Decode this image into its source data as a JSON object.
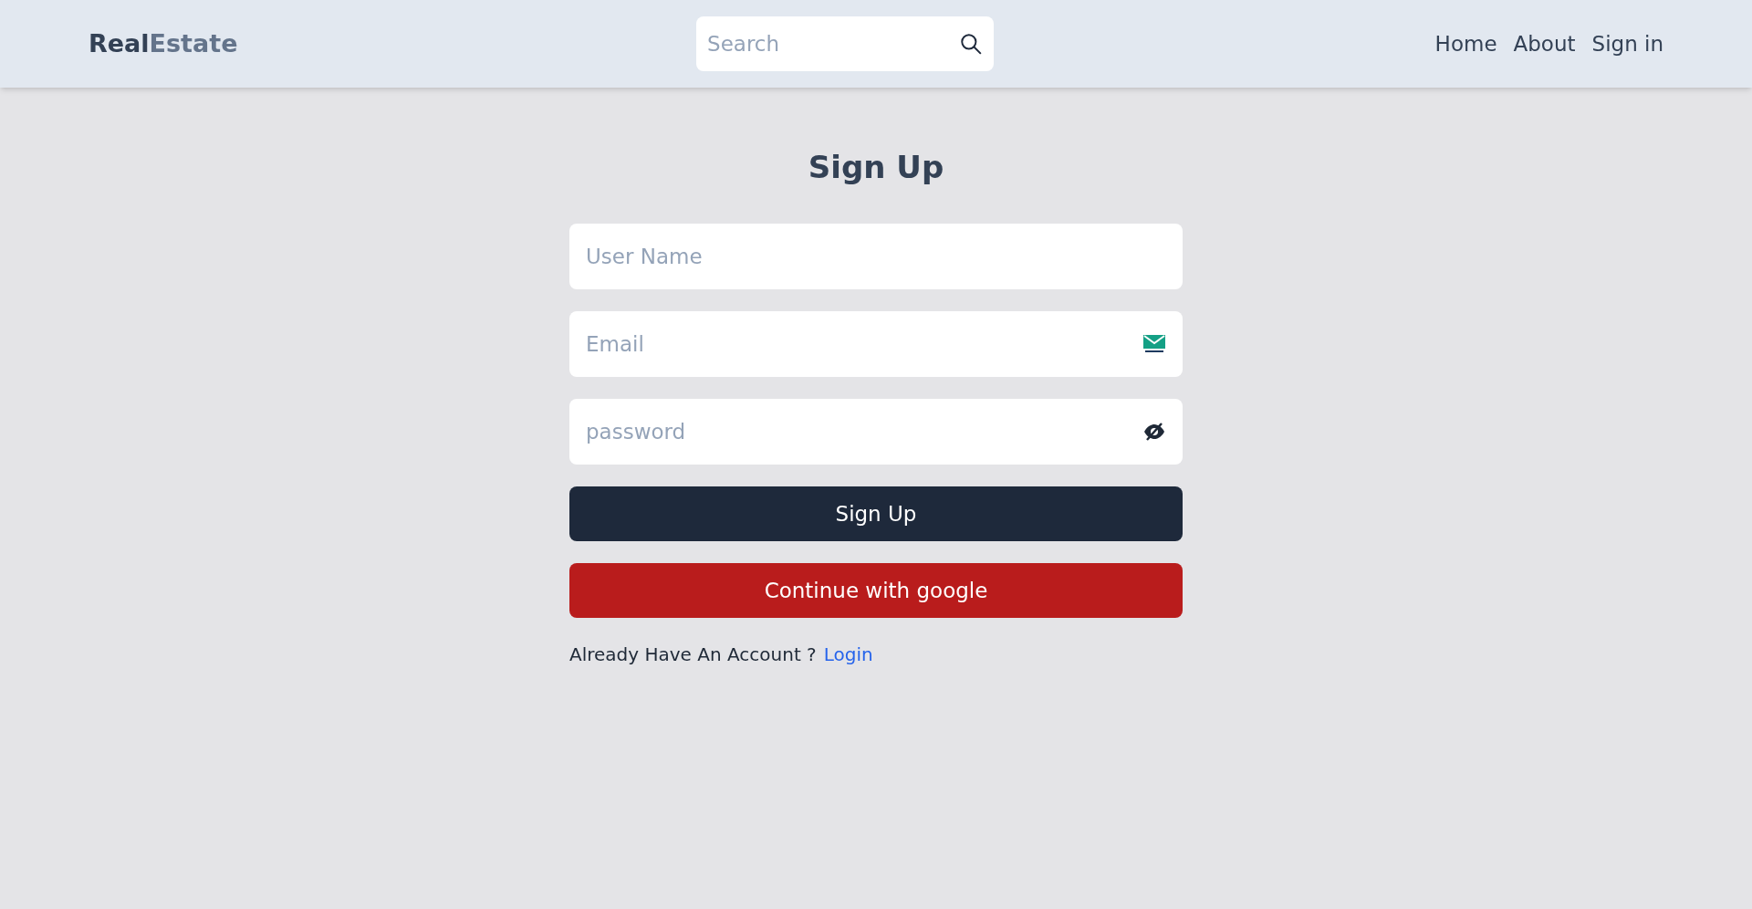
{
  "header": {
    "logo": [
      "Real",
      "Estate"
    ],
    "search": {
      "placeholder": "Search"
    },
    "nav": [
      "Home",
      "About",
      "Sign in"
    ]
  },
  "form": {
    "title": "Sign Up",
    "fields": [
      {
        "placeholder": "User Name",
        "kind": "text"
      },
      {
        "placeholder": "Email",
        "kind": "email"
      },
      {
        "placeholder": "password",
        "kind": "password"
      }
    ],
    "submit": "Sign Up",
    "google": "Continue with google",
    "footer": {
      "text": "Already Have An Account ?",
      "link": "Login"
    }
  }
}
